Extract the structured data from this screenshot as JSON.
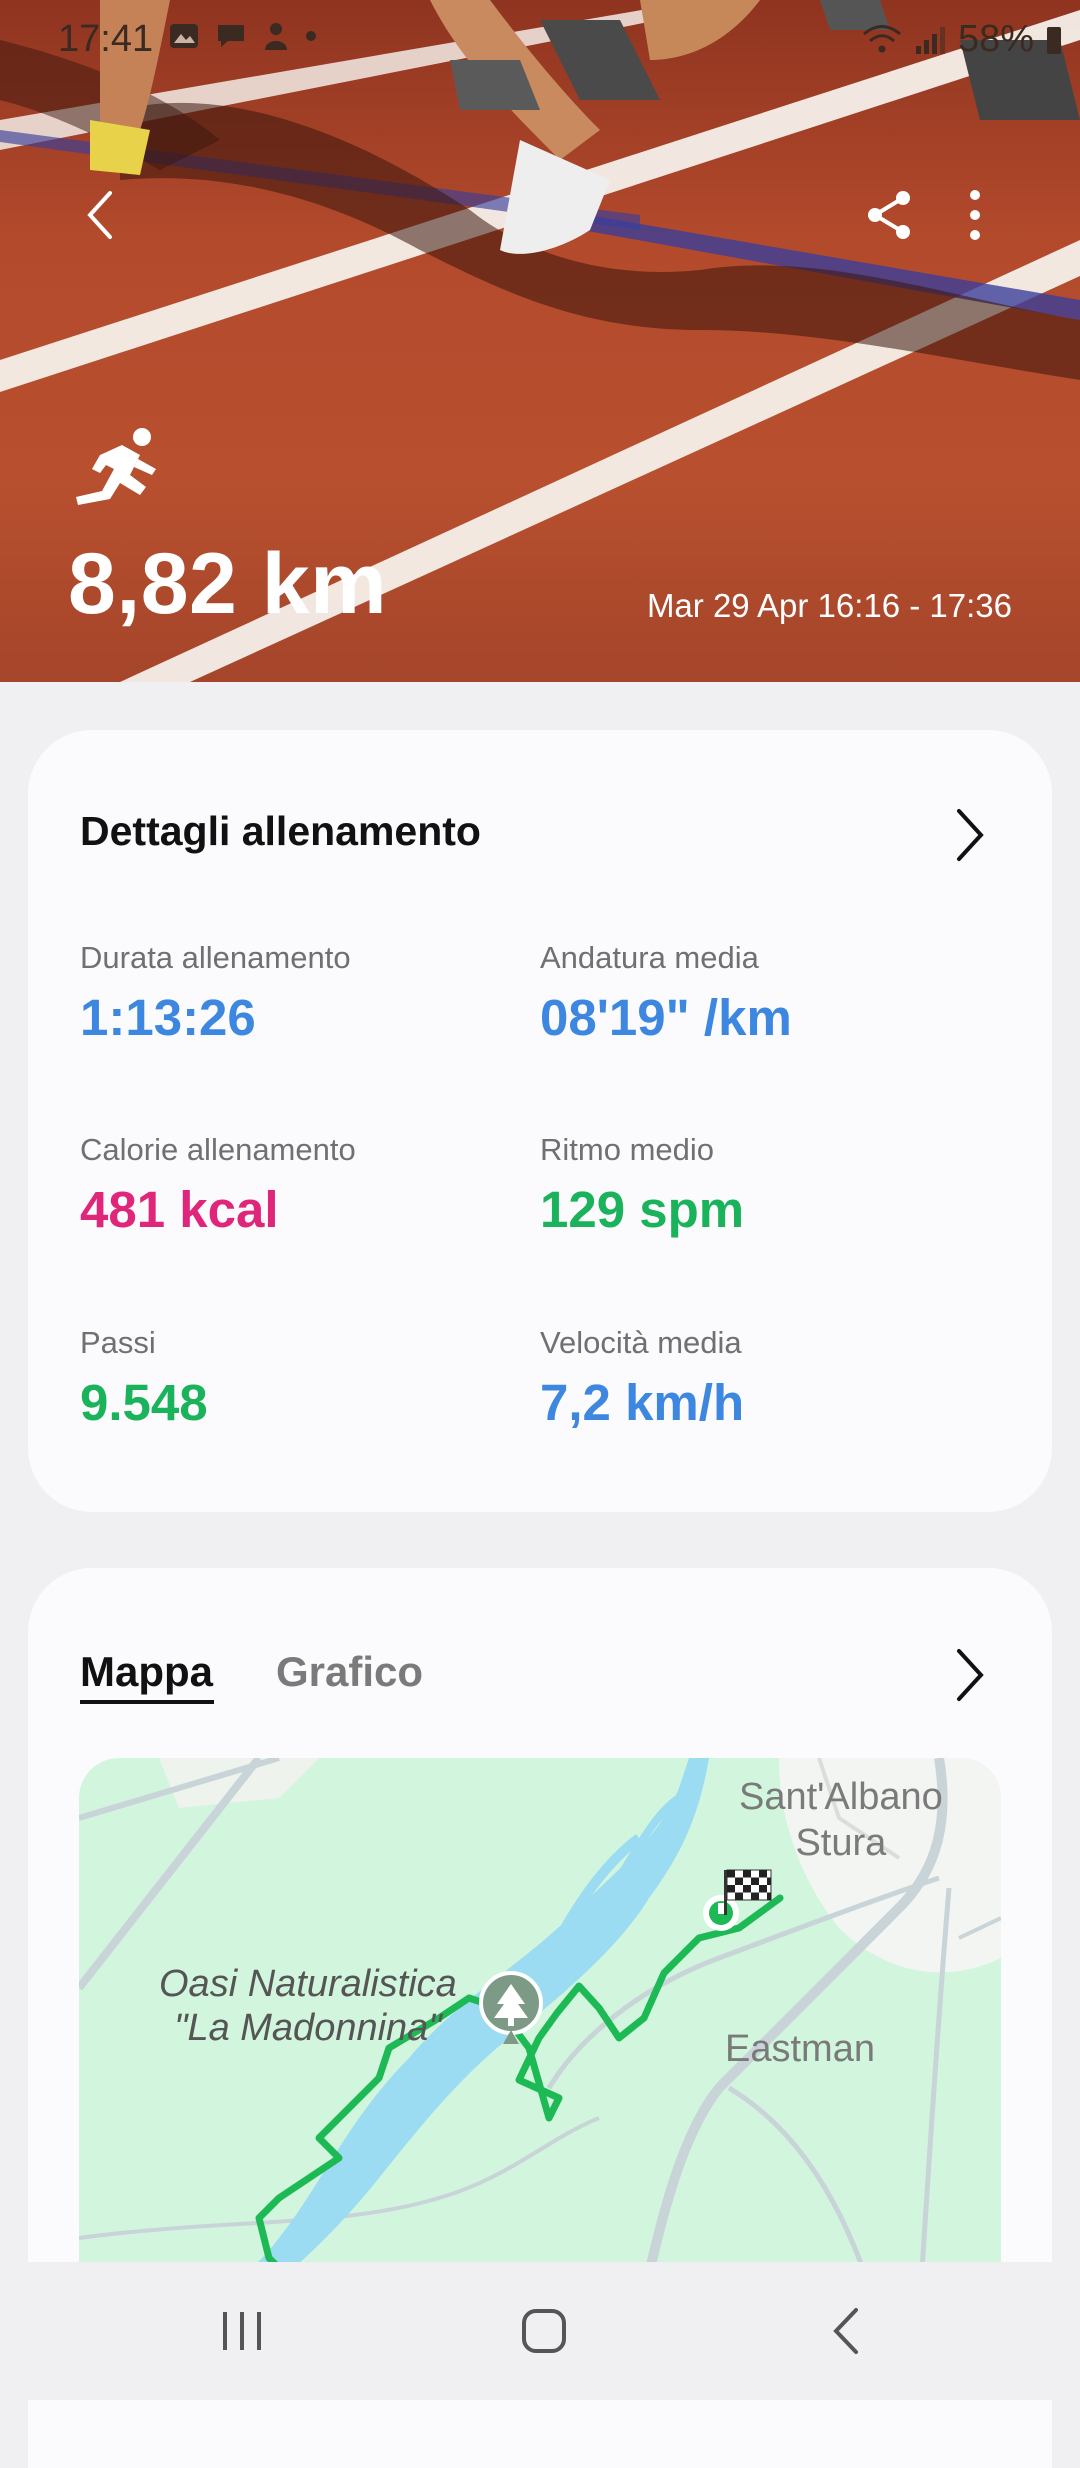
{
  "status_bar": {
    "time": "17:41",
    "battery": "58%"
  },
  "hero": {
    "distance": "8,82 km",
    "date_range": "Mar 29 Apr 16:16 - 17:36",
    "icons": [
      "back-icon",
      "share-icon",
      "more-options-icon",
      "running-icon"
    ]
  },
  "details": {
    "title": "Dettagli allenamento",
    "stats": [
      {
        "label": "Durata allenamento",
        "value": "1:13:26",
        "color": "#3d87e0"
      },
      {
        "label": "Andatura media",
        "value": "08'19\" /km",
        "color": "#3d87e0"
      },
      {
        "label": "Calorie allenamento",
        "value": "481 kcal",
        "color": "#e0267a"
      },
      {
        "label": "Ritmo medio",
        "value": "129 spm",
        "color": "#1ab25a"
      },
      {
        "label": "Passi",
        "value": "9.548",
        "color": "#1ab25a"
      },
      {
        "label": "Velocità media",
        "value": "7,2 km/h",
        "color": "#3d87e0"
      }
    ]
  },
  "map_card": {
    "tabs": [
      {
        "label": "Mappa",
        "active": true
      },
      {
        "label": "Grafico",
        "active": false
      }
    ],
    "labels": {
      "town": "Sant'Albano\nStura",
      "park_line1": "Oasi Naturalistica",
      "park_line2": "\"La Madonnina\"",
      "place": "Eastman"
    },
    "route_color": "#1db954",
    "water_color": "#9bdcf2"
  },
  "navbar": {
    "icons": [
      "recent-apps-icon",
      "home-icon",
      "back-icon"
    ]
  }
}
